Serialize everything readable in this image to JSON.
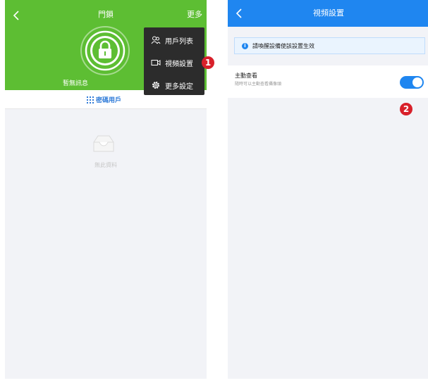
{
  "left_screen": {
    "title": "門鎖",
    "more_label": "更多",
    "lock_status": "暫無訊息",
    "tab_label": "密碼用戶",
    "empty_text": "無此資料",
    "menu": [
      {
        "label": "用戶列表",
        "icon": "users-icon"
      },
      {
        "label": "視頻設置",
        "icon": "video-icon"
      },
      {
        "label": "更多設定",
        "icon": "gear-icon"
      }
    ],
    "badge": "1"
  },
  "right_screen": {
    "title": "視頻設置",
    "notice": "請喚醒設備使該設置生效",
    "setting": {
      "title": "主動查看",
      "subtitle": "隨時可以主動查看攝像頭",
      "toggle_on": true
    },
    "badge": "2"
  },
  "colors": {
    "green_header": "#5dbe33",
    "blue_header": "#1f86f0",
    "badge_red": "#d8202a",
    "menu_bg": "#2c2c2c",
    "tab_blue": "#2f7bd8"
  }
}
